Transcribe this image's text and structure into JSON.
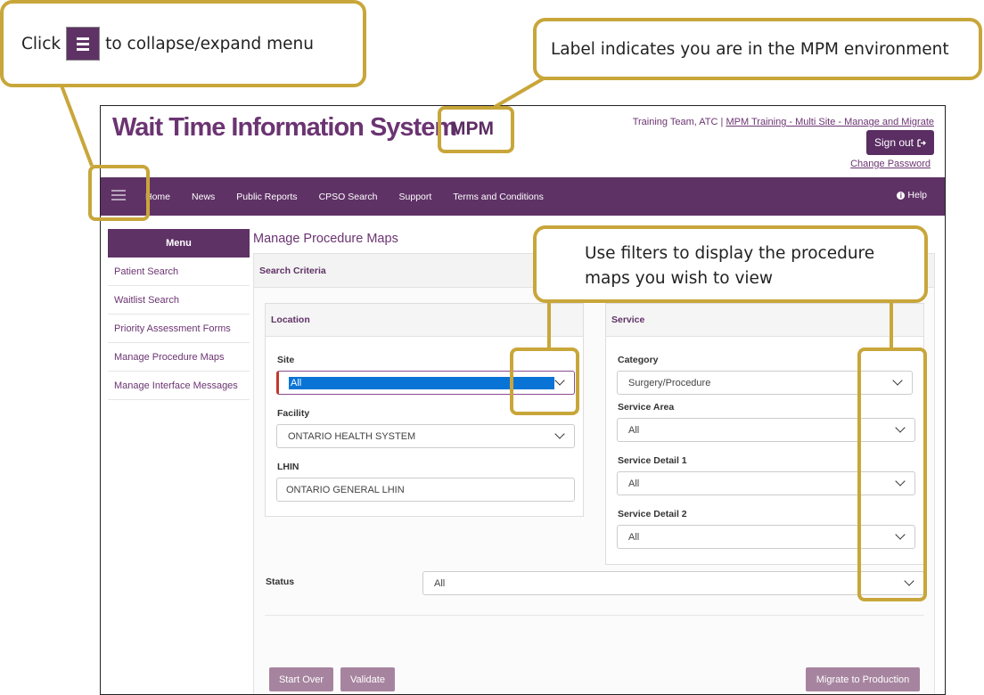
{
  "app": {
    "title": "Wait Time Information System",
    "environment_label": "MPM"
  },
  "header": {
    "user": "Training Team, ATC",
    "separator": " | ",
    "context_link": "MPM Training - Multi Site - Manage and Migrate",
    "sign_out_label": "Sign out",
    "change_password_label": "Change Password"
  },
  "navbar": {
    "menu_icon": "hamburger-icon",
    "items": [
      "Home",
      "News",
      "Public Reports",
      "CPSO Search",
      "Support",
      "Terms and Conditions"
    ],
    "help_label": "Help"
  },
  "sidebar": {
    "title": "Menu",
    "items": [
      "Patient Search",
      "Waitlist Search",
      "Priority Assessment Forms",
      "Manage Procedure Maps",
      "Manage Interface Messages"
    ]
  },
  "main": {
    "page_title": "Manage Procedure Maps",
    "search_criteria_label": "Search Criteria",
    "location": {
      "title": "Location",
      "site_label": "Site",
      "site_value": "All",
      "facility_label": "Facility",
      "facility_value": "ONTARIO HEALTH SYSTEM",
      "lhin_label": "LHIN",
      "lhin_value": "ONTARIO GENERAL LHIN"
    },
    "service": {
      "title": "Service",
      "category_label": "Category",
      "category_value": "Surgery/Procedure",
      "service_area_label": "Service Area",
      "service_area_value": "All",
      "service_detail1_label": "Service Detail 1",
      "service_detail1_value": "All",
      "service_detail2_label": "Service Detail 2",
      "service_detail2_value": "All"
    },
    "status_label": "Status",
    "status_value": "All",
    "buttons": {
      "start_over": "Start Over",
      "validate": "Validate",
      "migrate": "Migrate to Production"
    }
  },
  "callouts": {
    "menu_click_prefix": "Click",
    "menu_click_suffix": "to collapse/expand menu",
    "mpm_label": "Label indicates you are in the MPM environment",
    "filters": "Use filters to display the procedure maps you wish to view"
  },
  "colors": {
    "brand_purple": "#5f3266",
    "callout_gold": "#c8a63a",
    "selection_blue": "#0a74d6"
  }
}
